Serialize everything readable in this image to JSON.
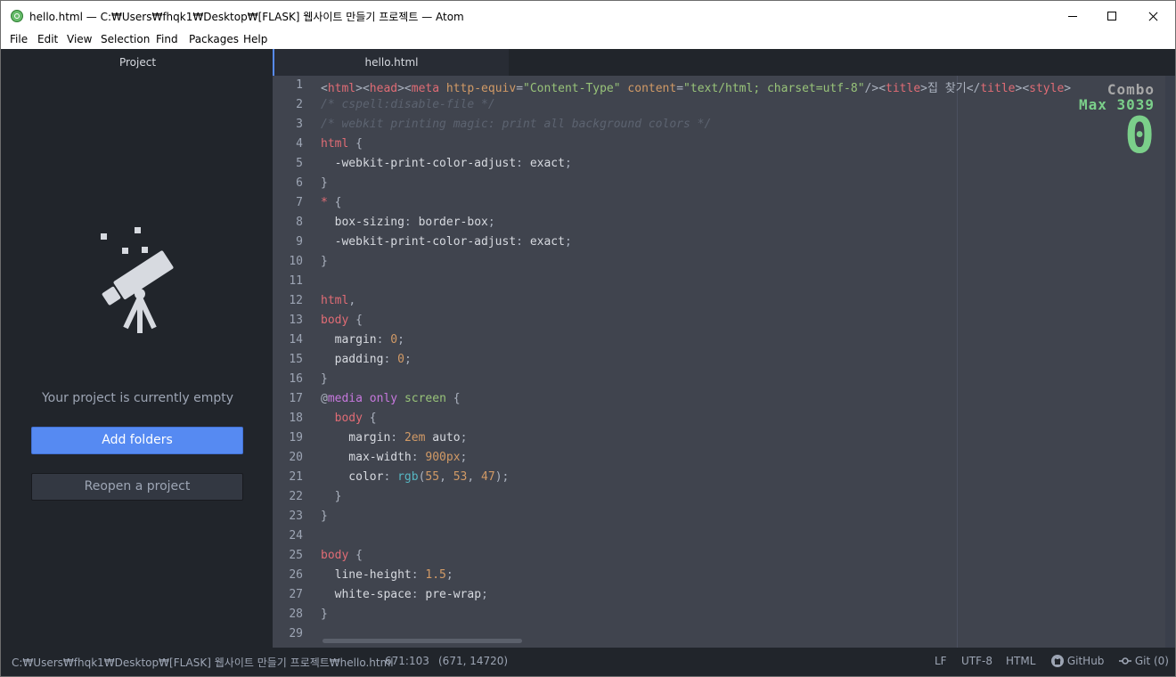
{
  "window": {
    "title": "hello.html — C:₩Users₩fhqk1₩Desktop₩[FLASK] 웹사이트 만들기 프로젝트 — Atom"
  },
  "menu": [
    "File",
    "Edit",
    "View",
    "Selection",
    "Find",
    "Packages",
    "Help"
  ],
  "tree": {
    "header": "Project",
    "empty_message": "Your project is currently empty",
    "add_folders": "Add folders",
    "reopen_project": "Reopen a project"
  },
  "tabs": [
    {
      "label": "hello.html",
      "active": true
    }
  ],
  "editor": {
    "line_numbers": [
      "1",
      "2",
      "3",
      "4",
      "5",
      "6",
      "7",
      "8",
      "9",
      "10",
      "11",
      "12",
      "13",
      "14",
      "15",
      "16",
      "17",
      "18",
      "19",
      "20",
      "21",
      "22",
      "23",
      "24",
      "25",
      "26",
      "27",
      "28",
      "29"
    ],
    "lines": [
      [
        [
          "t-p",
          "<"
        ],
        [
          "t-tag",
          "html"
        ],
        [
          "t-p",
          "><"
        ],
        [
          "t-tag",
          "head"
        ],
        [
          "t-p",
          "><"
        ],
        [
          "t-tag",
          "meta"
        ],
        [
          "t-p",
          " "
        ],
        [
          "t-attr",
          "http-equiv"
        ],
        [
          "t-p",
          "="
        ],
        [
          "t-str",
          "\"Content-Type\""
        ],
        [
          "t-p",
          " "
        ],
        [
          "t-attr",
          "content"
        ],
        [
          "t-p",
          "="
        ],
        [
          "t-str",
          "\"text/html; charset=utf-8\""
        ],
        [
          "t-p",
          "/><"
        ],
        [
          "t-tag",
          "title"
        ],
        [
          "t-p",
          ">집 찾기</"
        ],
        [
          "t-tag",
          "title"
        ],
        [
          "t-p",
          "><"
        ],
        [
          "t-tag",
          "style"
        ],
        [
          "t-p",
          ">"
        ]
      ],
      [
        [
          "t-com",
          "/* cspell:disable-file */"
        ]
      ],
      [
        [
          "t-com",
          "/* webkit printing magic: print all background colors */"
        ]
      ],
      [
        [
          "t-tag",
          "html"
        ],
        [
          "t-p",
          " {"
        ]
      ],
      [
        [
          "t-prop",
          "  -webkit-print-color-adjust"
        ],
        [
          "t-p",
          ": "
        ],
        [
          "t-prop",
          "exact"
        ],
        [
          "t-p",
          ";"
        ]
      ],
      [
        [
          "t-p",
          "}"
        ]
      ],
      [
        [
          "t-tag",
          "*"
        ],
        [
          "t-p",
          " {"
        ]
      ],
      [
        [
          "t-prop",
          "  box-sizing"
        ],
        [
          "t-p",
          ": "
        ],
        [
          "t-prop",
          "border-box"
        ],
        [
          "t-p",
          ";"
        ]
      ],
      [
        [
          "t-prop",
          "  -webkit-print-color-adjust"
        ],
        [
          "t-p",
          ": "
        ],
        [
          "t-prop",
          "exact"
        ],
        [
          "t-p",
          ";"
        ]
      ],
      [
        [
          "t-p",
          "}"
        ]
      ],
      [],
      [
        [
          "t-tag",
          "html"
        ],
        [
          "t-p",
          ","
        ]
      ],
      [
        [
          "t-tag",
          "body"
        ],
        [
          "t-p",
          " {"
        ]
      ],
      [
        [
          "t-prop",
          "  margin"
        ],
        [
          "t-p",
          ": "
        ],
        [
          "t-num",
          "0"
        ],
        [
          "t-p",
          ";"
        ]
      ],
      [
        [
          "t-prop",
          "  padding"
        ],
        [
          "t-p",
          ": "
        ],
        [
          "t-num",
          "0"
        ],
        [
          "t-p",
          ";"
        ]
      ],
      [
        [
          "t-p",
          "}"
        ]
      ],
      [
        [
          "t-p",
          "@"
        ],
        [
          "t-at",
          "media"
        ],
        [
          "t-p",
          " "
        ],
        [
          "t-kw",
          "only"
        ],
        [
          "t-p",
          " "
        ],
        [
          "t-str",
          "screen"
        ],
        [
          "t-p",
          " {"
        ]
      ],
      [
        [
          "t-tag",
          "  body"
        ],
        [
          "t-p",
          " {"
        ]
      ],
      [
        [
          "t-prop",
          "    margin"
        ],
        [
          "t-p",
          ": "
        ],
        [
          "t-num",
          "2em"
        ],
        [
          "t-p",
          " "
        ],
        [
          "t-prop",
          "auto"
        ],
        [
          "t-p",
          ";"
        ]
      ],
      [
        [
          "t-prop",
          "    max-width"
        ],
        [
          "t-p",
          ": "
        ],
        [
          "t-num",
          "900px"
        ],
        [
          "t-p",
          ";"
        ]
      ],
      [
        [
          "t-prop",
          "    color"
        ],
        [
          "t-p",
          ": "
        ],
        [
          "t-fn",
          "rgb"
        ],
        [
          "t-p",
          "("
        ],
        [
          "t-num",
          "55"
        ],
        [
          "t-p",
          ", "
        ],
        [
          "t-num",
          "53"
        ],
        [
          "t-p",
          ", "
        ],
        [
          "t-num",
          "47"
        ],
        [
          "t-p",
          ");"
        ]
      ],
      [
        [
          "t-p",
          "  }"
        ]
      ],
      [
        [
          "t-p",
          "}"
        ]
      ],
      [],
      [
        [
          "t-tag",
          "body"
        ],
        [
          "t-p",
          " {"
        ]
      ],
      [
        [
          "t-prop",
          "  line-height"
        ],
        [
          "t-p",
          ": "
        ],
        [
          "t-num",
          "1.5"
        ],
        [
          "t-p",
          ";"
        ]
      ],
      [
        [
          "t-prop",
          "  white-space"
        ],
        [
          "t-p",
          ": "
        ],
        [
          "t-prop",
          "pre-wrap"
        ],
        [
          "t-p",
          ";"
        ]
      ],
      [
        [
          "t-p",
          "}"
        ]
      ],
      []
    ]
  },
  "combo": {
    "label": "Combo",
    "max": "Max 3039",
    "count": "0"
  },
  "status": {
    "path": "C:₩Users₩fhqk1₩Desktop₩[FLASK] 웹사이트 만들기 프로젝트₩hello.html",
    "cursor": "671:103",
    "selection": "(671, 14720)",
    "line_ending": "LF",
    "encoding": "UTF-8",
    "grammar": "HTML",
    "github": "GitHub",
    "git": "Git (0)"
  },
  "icons": [
    "atom-icon",
    "minimize-icon",
    "maximize-icon",
    "close-icon",
    "telescope-icon",
    "github-icon",
    "git-commit-icon"
  ],
  "colors": {
    "accent": "#568af2",
    "editor_bg": "#40444e",
    "panel_bg": "#21252b",
    "combo_green": "#7bcf8a"
  }
}
